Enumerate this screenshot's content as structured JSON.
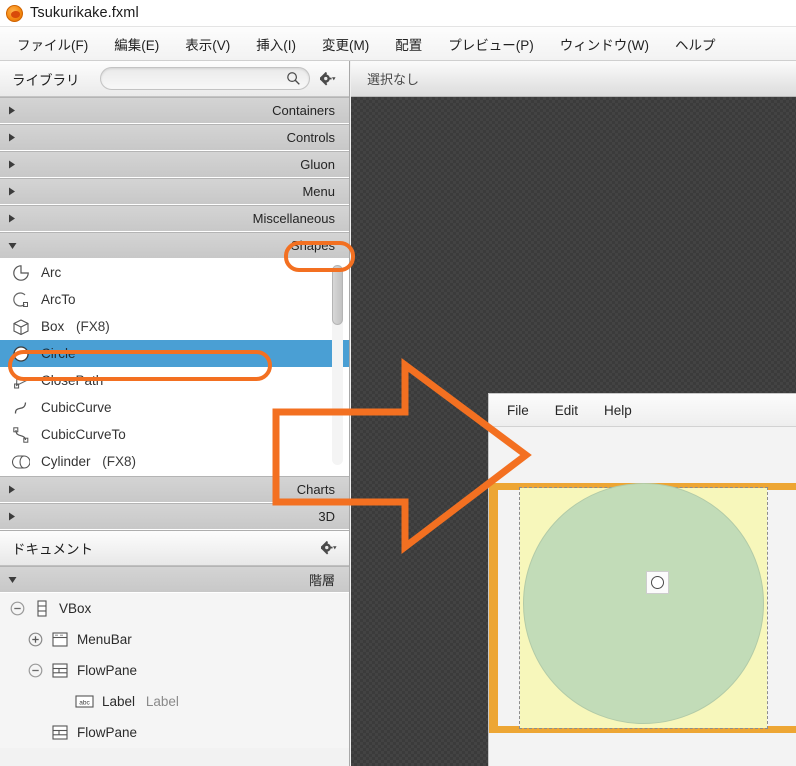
{
  "window": {
    "title": "Tsukurikake.fxml",
    "logo_icon": "scenebuilder-logo-icon"
  },
  "menubar": {
    "items": [
      {
        "label": "ファイル(F)",
        "name": "menu-file"
      },
      {
        "label": "編集(E)",
        "name": "menu-edit"
      },
      {
        "label": "表示(V)",
        "name": "menu-view"
      },
      {
        "label": "挿入(I)",
        "name": "menu-insert"
      },
      {
        "label": "変更(M)",
        "name": "menu-modify"
      },
      {
        "label": "配置",
        "name": "menu-arrange"
      },
      {
        "label": "プレビュー(P)",
        "name": "menu-preview"
      },
      {
        "label": "ウィンドウ(W)",
        "name": "menu-window"
      },
      {
        "label": "ヘルプ",
        "name": "menu-help"
      }
    ]
  },
  "library": {
    "title": "ライブラリ",
    "search_value": "",
    "search_placeholder": "",
    "search_icon": "search-icon",
    "gear_icon": "gear-dropdown-icon",
    "sections_above": [
      {
        "label": "Containers",
        "expanded": false
      },
      {
        "label": "Controls",
        "expanded": false
      },
      {
        "label": "Gluon",
        "expanded": false
      },
      {
        "label": "Menu",
        "expanded": false
      },
      {
        "label": "Miscellaneous",
        "expanded": false
      },
      {
        "label": "Shapes",
        "expanded": true
      }
    ],
    "shapes": [
      {
        "label": "Arc",
        "suffix": "",
        "icon": "arc-icon",
        "selected": false
      },
      {
        "label": "ArcTo",
        "suffix": "",
        "icon": "arcto-icon",
        "selected": false
      },
      {
        "label": "Box",
        "suffix": "(FX8)",
        "icon": "box-icon",
        "selected": false
      },
      {
        "label": "Circle",
        "suffix": "",
        "icon": "circle-icon",
        "selected": true
      },
      {
        "label": "ClosePath",
        "suffix": "",
        "icon": "closepath-icon",
        "selected": false
      },
      {
        "label": "CubicCurve",
        "suffix": "",
        "icon": "cubiccurve-icon",
        "selected": false
      },
      {
        "label": "CubicCurveTo",
        "suffix": "",
        "icon": "cubiccurveto-icon",
        "selected": false
      },
      {
        "label": "Cylinder",
        "suffix": "(FX8)",
        "icon": "cylinder-icon",
        "selected": false
      }
    ],
    "sections_below": [
      {
        "label": "Charts",
        "expanded": false
      },
      {
        "label": "3D",
        "expanded": false
      }
    ]
  },
  "document": {
    "title": "ドキュメント",
    "gear_icon": "gear-dropdown-icon",
    "hierarchy_label": "階層",
    "tree": [
      {
        "label": "VBox",
        "extra": "",
        "indent": 0,
        "twisty": "collapse",
        "icon": "vbox-icon"
      },
      {
        "label": "MenuBar",
        "extra": "",
        "indent": 1,
        "twisty": "expand",
        "icon": "menubar-icon"
      },
      {
        "label": "FlowPane",
        "extra": "",
        "indent": 1,
        "twisty": "collapse",
        "icon": "flowpane-icon"
      },
      {
        "label": "Label",
        "extra": "Label",
        "indent": 2,
        "twisty": "none",
        "icon": "label-icon"
      },
      {
        "label": "FlowPane",
        "extra": "",
        "indent": 1,
        "twisty": "none",
        "icon": "flowpane-icon"
      }
    ]
  },
  "canvas": {
    "selection_text": "選択なし"
  },
  "preview": {
    "menu_items": [
      "File",
      "Edit",
      "Help"
    ],
    "drag_badge_icon": "circle-drop-indicator-icon"
  },
  "colors": {
    "accent_orange": "#f37021",
    "selection_blue": "#4a9fd4",
    "preview_frame_orange": "#eda634",
    "preview_yellow": "#f7f7bb",
    "preview_green": "#c2dcb8",
    "canvas_dark": "#434343"
  },
  "annotations": [
    {
      "name": "shapes-highlight",
      "target": "Shapes"
    },
    {
      "name": "circle-highlight",
      "target": "Circle"
    },
    {
      "name": "drag-arrow",
      "target": "preview-window"
    }
  ]
}
